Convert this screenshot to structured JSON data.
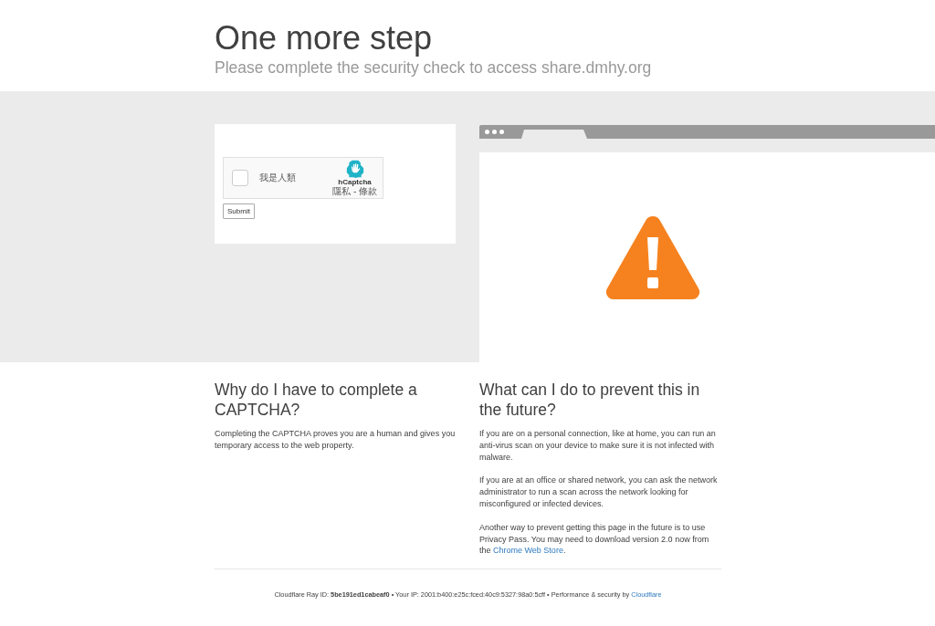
{
  "header": {
    "title": "One more step",
    "subtitle": "Please complete the security check to access share.dmhy.org"
  },
  "captcha": {
    "checked": false,
    "label": "我是人類",
    "brand": "hCaptcha",
    "links": "隱私 - 條款",
    "submit": "Submit"
  },
  "sections": [
    {
      "heading": "Why do I have to complete a CAPTCHA?",
      "paragraphs": [
        {
          "text": "Completing the CAPTCHA proves you are a human and gives you temporary access to the web property."
        }
      ]
    },
    {
      "heading": "What can I do to prevent this in the future?",
      "paragraphs": [
        {
          "text": "If you are on a personal connection, like at home, you can run an anti-virus scan on your device to make sure it is not infected with malware."
        },
        {
          "text": "If you are at an office or shared network, you can ask the network administrator to run a scan across the network looking for misconfigured or infected devices."
        },
        {
          "text": "Another way to prevent getting this page in the future is to use Privacy Pass. You may need to download version 2.0 now from the ",
          "link": "Chrome Web Store",
          "after": "."
        }
      ]
    }
  ],
  "footer": {
    "ray": "Cloudflare Ray ID: **5be191ed1cabeaf0**",
    "separator": "•",
    "ip": "Your IP: 2001:b400:e25c:fced:40c9:5327:98a0:5cff",
    "performance": "Performance & security by ",
    "link": "Cloudflare"
  }
}
